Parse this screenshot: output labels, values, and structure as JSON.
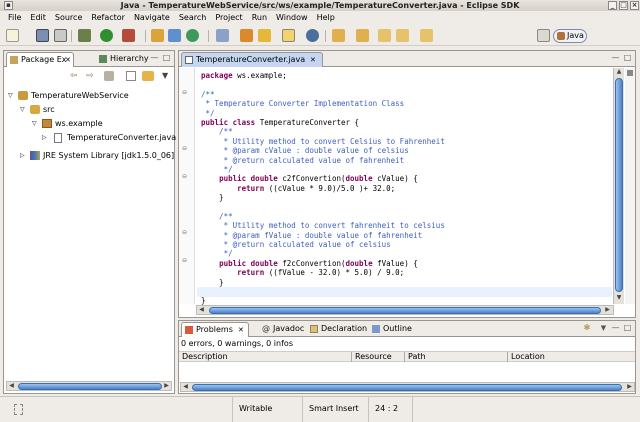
{
  "window": {
    "title": "Java - TemperatureWebService/src/ws/example/TemperatureConverter.java - Eclipse SDK"
  },
  "menu": [
    "File",
    "Edit",
    "Source",
    "Refactor",
    "Navigate",
    "Search",
    "Project",
    "Run",
    "Window",
    "Help"
  ],
  "perspective": {
    "label": "Java"
  },
  "left_panel": {
    "tabs": [
      "Package Ex",
      "Hierarchy"
    ],
    "tree": [
      {
        "label": "TemperatureWebService",
        "icon": "project-icon"
      },
      {
        "label": "src",
        "icon": "source-folder-icon"
      },
      {
        "label": "ws.example",
        "icon": "package-icon"
      },
      {
        "label": "TemperatureConverter.java",
        "icon": "java-file-icon"
      },
      {
        "label": "JRE System Library [jdk1.5.0_06]",
        "icon": "library-icon"
      }
    ]
  },
  "editor": {
    "tab": "TemperatureConverter.java",
    "lines": [
      "package ws.example;",
      "",
      "/**",
      " * Temperature Converter Implementation Class",
      " */",
      "public class TemperatureConverter {",
      "    /**",
      "     * Utility method to convert Celsius to Fahrenheit",
      "     * @param cValue : double value of celsius",
      "     * @return calculated value of fahrenheit",
      "     */",
      "    public double c2fConvertion(double cValue) {",
      "        return ((cValue * 9.0)/5.0 )+ 32.0;",
      "    }",
      "",
      "    /**",
      "     * Utility method to convert fahrenheit to celsius",
      "     * @param fValue : double value of fahrenheit",
      "     * @return calculated value of celsius",
      "     */",
      "    public double f2cConvertion(double fValue) {",
      "        return ((fValue - 32.0) * 5.0) / 9.0;",
      "    }",
      "",
      "}"
    ]
  },
  "bottom_panel": {
    "tabs": [
      "Problems",
      "Javadoc",
      "Declaration",
      "Outline"
    ],
    "summary": "0 errors, 0 warnings, 0 infos",
    "columns": [
      "Description",
      "Resource",
      "Path",
      "Location"
    ]
  },
  "status": {
    "mode": "Writable",
    "insert": "Smart Insert",
    "position": "24 : 2"
  }
}
